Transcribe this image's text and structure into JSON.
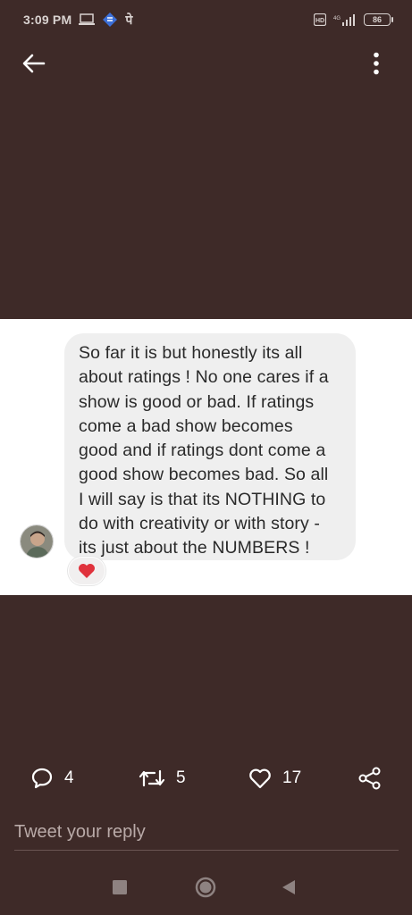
{
  "status_bar": {
    "time": "3:09 PM",
    "devanagari_glyph": "पे",
    "battery": "86",
    "icons": [
      "laptop-icon",
      "app-icon",
      "devanagari-icon",
      "hd-icon",
      "signal-icon",
      "battery-icon"
    ]
  },
  "top_bar": {
    "back_icon": "arrow-left-icon",
    "menu_icon": "more-vertical-icon"
  },
  "message": {
    "text": "So far it is but honestly its all\nabout ratings ! No one cares if a\nshow is good or bad. If ratings\ncome a bad show becomes\ngood and if ratings dont come a\ngood show becomes bad. So all\nI will say is that its NOTHING to\ndo with creativity or with story -\nits just about the NUMBERS !",
    "reaction_icon": "heart-icon",
    "reaction_color": "#e0323c"
  },
  "actions": {
    "replies": "4",
    "retweets": "5",
    "likes": "17",
    "icons": [
      "comment-icon",
      "retweet-icon",
      "heart-outline-icon",
      "share-icon"
    ]
  },
  "reply": {
    "placeholder": "Tweet your reply"
  },
  "colors": {
    "background": "#3e2a28",
    "bubble": "#efefef"
  }
}
